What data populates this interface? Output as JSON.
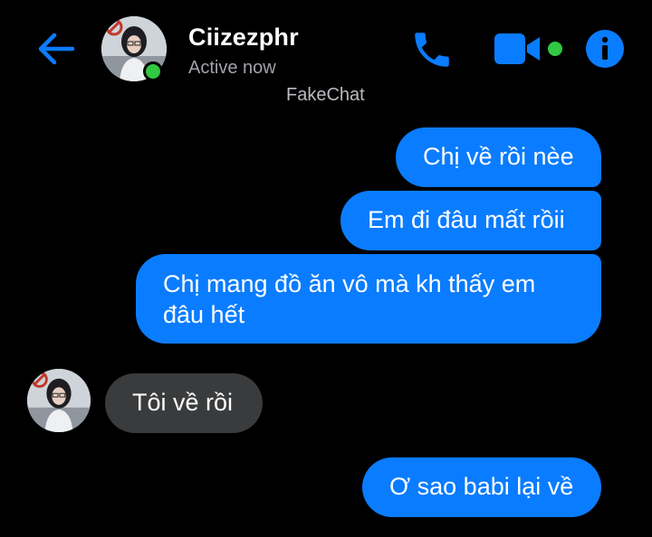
{
  "app": {
    "name": "FakeChat"
  },
  "header": {
    "contact_name": "Ciizezphr",
    "status": "Active now",
    "colors": {
      "accent": "#0a7cff",
      "online": "#31c843"
    },
    "icons": [
      "back-arrow-icon",
      "phone-icon",
      "video-camera-icon",
      "info-icon"
    ]
  },
  "messages": [
    {
      "direction": "outgoing",
      "text": "Chị về rồi nèe"
    },
    {
      "direction": "outgoing",
      "text": "Em đi đâu mất rồii"
    },
    {
      "direction": "outgoing",
      "text": "Chị mang đồ ăn vô mà kh thấy em đâu hết"
    },
    {
      "direction": "incoming",
      "text": "Tôi về rồi"
    },
    {
      "direction": "outgoing",
      "text": "Ơ sao babi lại về"
    }
  ],
  "colors": {
    "outgoing_bubble": "#0a7cff",
    "incoming_bubble": "#3a3b3c",
    "background": "#000000"
  }
}
